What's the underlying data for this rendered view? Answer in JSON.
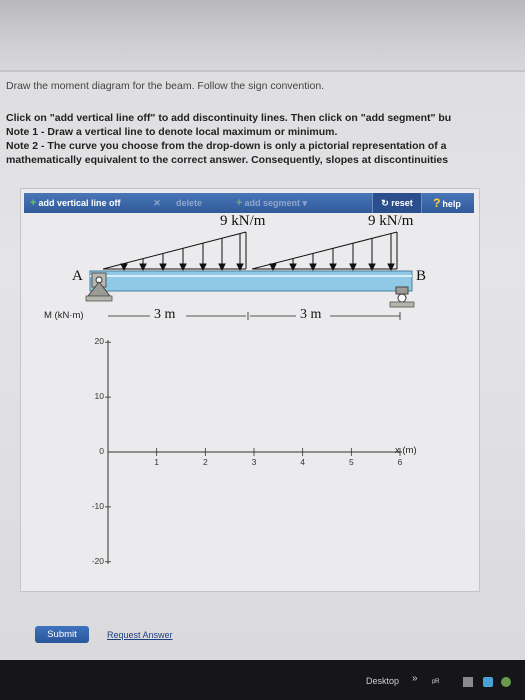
{
  "instructions": {
    "title": "Draw the moment diagram for the beam. Follow the sign convention.",
    "line1": "Click on \"add vertical line off\" to add discontinuity lines. Then click on \"add segment\" bu",
    "line2": "Note 1 - Draw a vertical line to denote local maximum or minimum.",
    "line3": "Note 2 - The curve you choose from the drop-down is only a pictorial representation of a",
    "line4": "mathematically equivalent to the correct answer. Consequently, slopes at discontinuities"
  },
  "toolbar": {
    "add_vertical_line": "add vertical line off",
    "delete": "delete",
    "add_segment": "add segment",
    "reset": "reset",
    "help": "help"
  },
  "beam": {
    "load_left": "9 kN/m",
    "load_right": "9 kN/m",
    "support_a": "A",
    "support_b": "B",
    "span_left": "3 m",
    "span_right": "3 m"
  },
  "graph": {
    "ylabel": "M (kN·m)",
    "xlabel": "x (m)",
    "y_ticks": [
      "20",
      "10",
      "0",
      "-10",
      "-20"
    ],
    "x_ticks": [
      "1",
      "2",
      "3",
      "4",
      "5",
      "6"
    ],
    "x_range": [
      0,
      6
    ],
    "y_range": [
      -20,
      20
    ]
  },
  "footer": {
    "submit": "Submit",
    "request_answer": "Request Answer"
  },
  "taskbar": {
    "desktop": "Desktop"
  },
  "colors": {
    "toolbar": "#3a66aa",
    "beam": "#8fc9e6",
    "submit": "#2f5fab"
  }
}
